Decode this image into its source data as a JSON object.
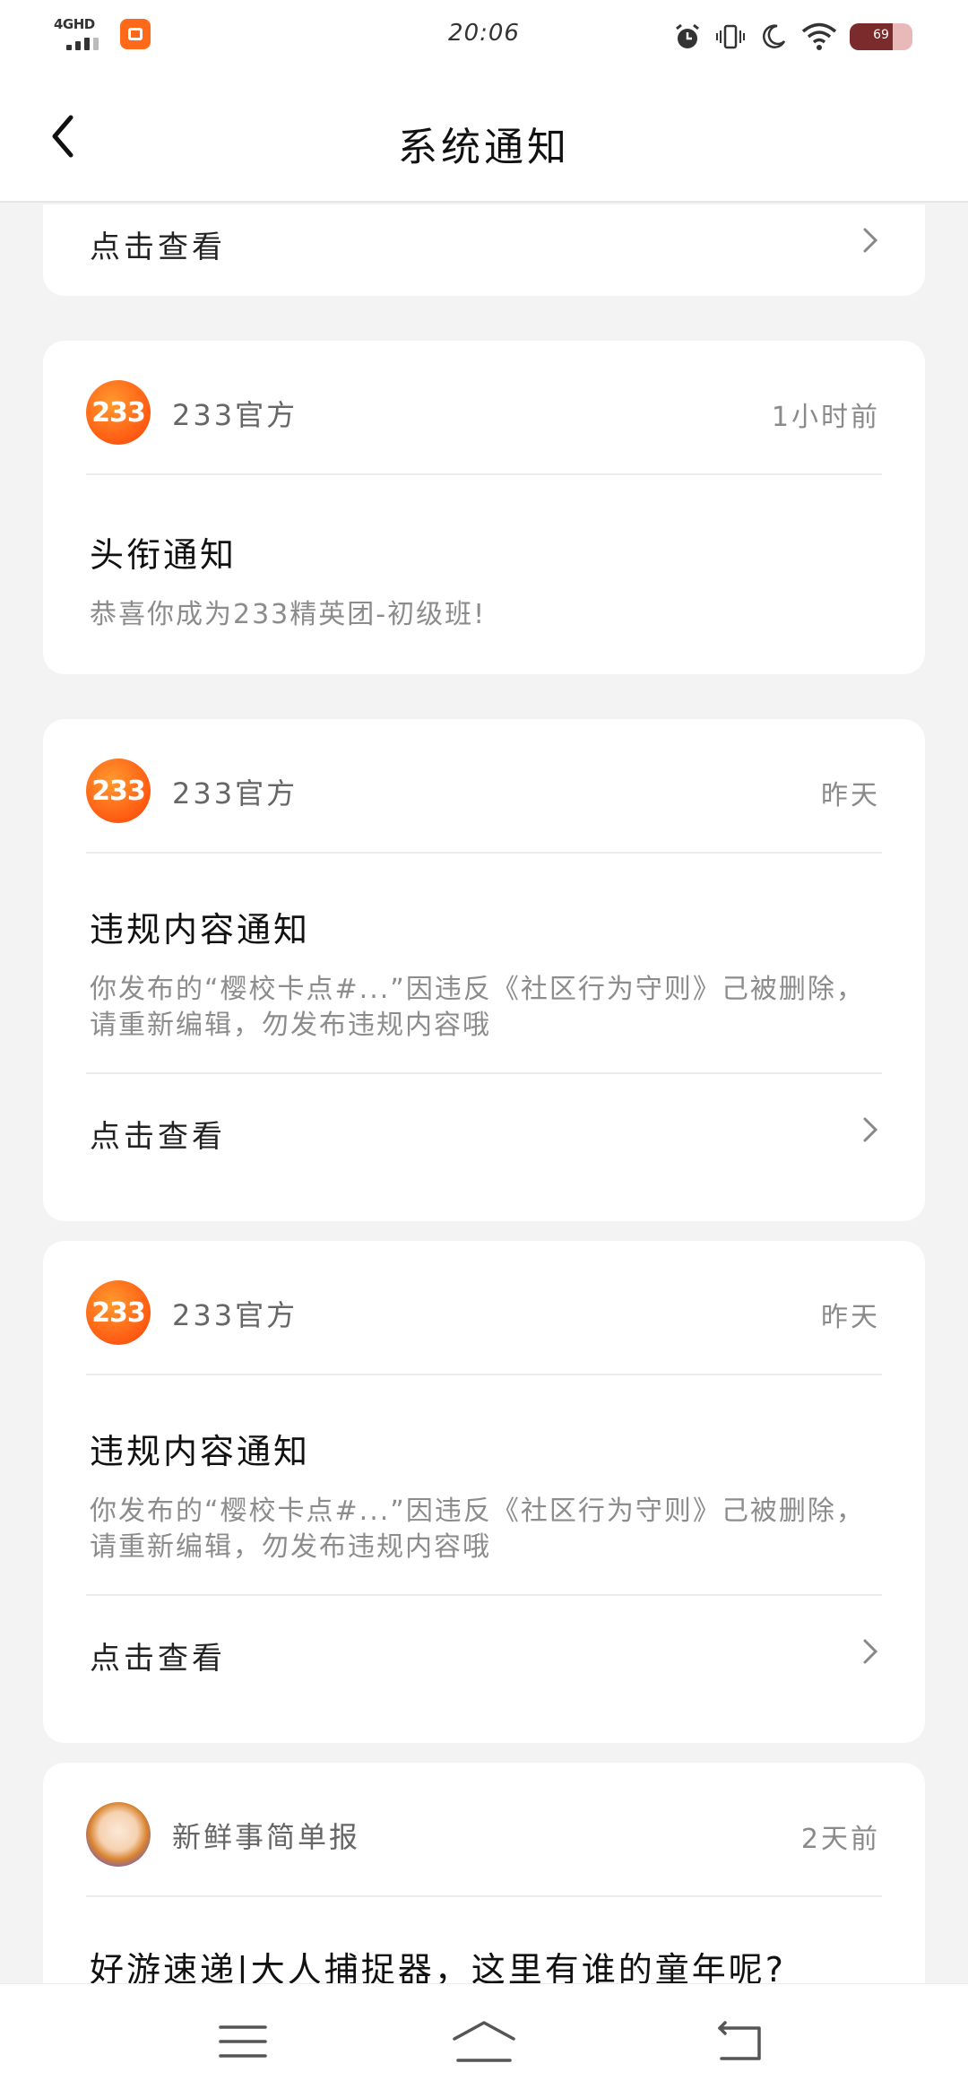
{
  "status_bar": {
    "network": "4GHD",
    "time": "20:06",
    "battery": "69",
    "battery_level": 0.69,
    "icons": [
      "signal-icon",
      "app-notification-icon",
      "alarm-icon",
      "vibrate-icon",
      "moon-icon",
      "wifi-icon",
      "battery-icon"
    ]
  },
  "header": {
    "title": "系统通知",
    "back_icon": "back-arrow-icon"
  },
  "partial_card": {
    "link_label": "点击查看"
  },
  "notifications": [
    {
      "sender": "233官方",
      "avatar_text": "233",
      "time": "1小时前",
      "title": "头衔通知",
      "body": "恭喜你成为233精英团-初级班!"
    },
    {
      "sender": "233官方",
      "avatar_text": "233",
      "time": "昨天",
      "title": "违规内容通知",
      "body": "你发布的“樱校卡点#...”因违反《社区行为守则》己被删除，请重新编辑，勿发布违规内容哦",
      "link_label": "点击查看"
    },
    {
      "sender": "233官方",
      "avatar_text": "233",
      "time": "昨天",
      "title": "违规内容通知",
      "body": "你发布的“樱校卡点#...”因违反《社区行为守则》己被删除，请重新编辑，勿发布违规内容哦",
      "link_label": "点击查看"
    },
    {
      "sender": "新鲜事简单报",
      "time": "2天前",
      "title": "好游速递|大人捕捉器，这里有谁的童年呢?"
    }
  ],
  "bottom_nav": {
    "icons": [
      "menu-icon",
      "home-icon",
      "back-icon"
    ]
  },
  "colors": {
    "accent": "#ff6a1a",
    "background": "#f3f3f3",
    "card": "#ffffff"
  }
}
